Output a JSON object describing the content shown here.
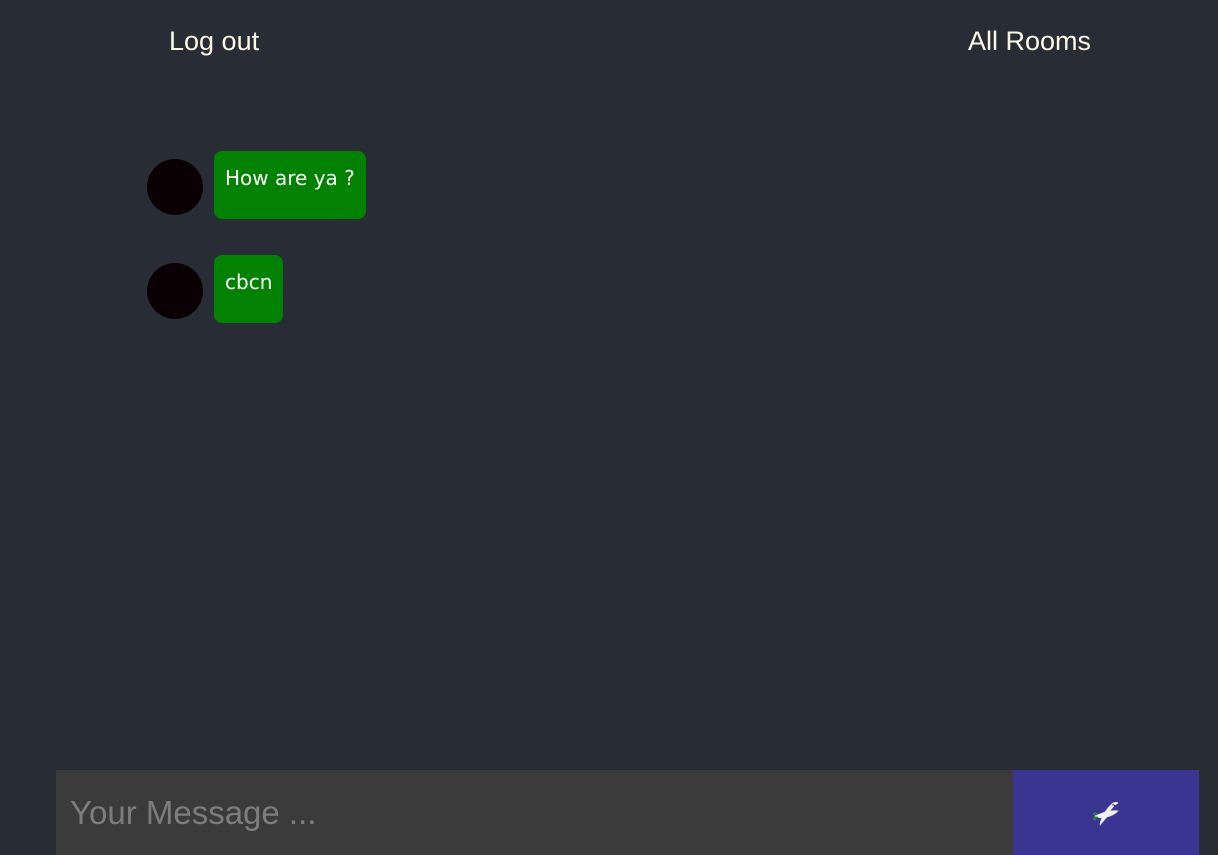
{
  "header": {
    "logout_label": "Log out",
    "rooms_label": "All Rooms"
  },
  "messages": [
    {
      "text": "How are ya ?",
      "bubble_color": "#028102",
      "avatar_color": "#0a0003"
    },
    {
      "text": "cbcn",
      "bubble_color": "#028102",
      "avatar_color": "#0a0003"
    }
  ],
  "composer": {
    "placeholder": "Your Message ...",
    "value": "",
    "send_icon": "dove-icon",
    "send_color": "#3a3591"
  },
  "colors": {
    "background": "#282c34",
    "nav_text": "#fff8e7",
    "input_background": "#3b3b3b"
  }
}
